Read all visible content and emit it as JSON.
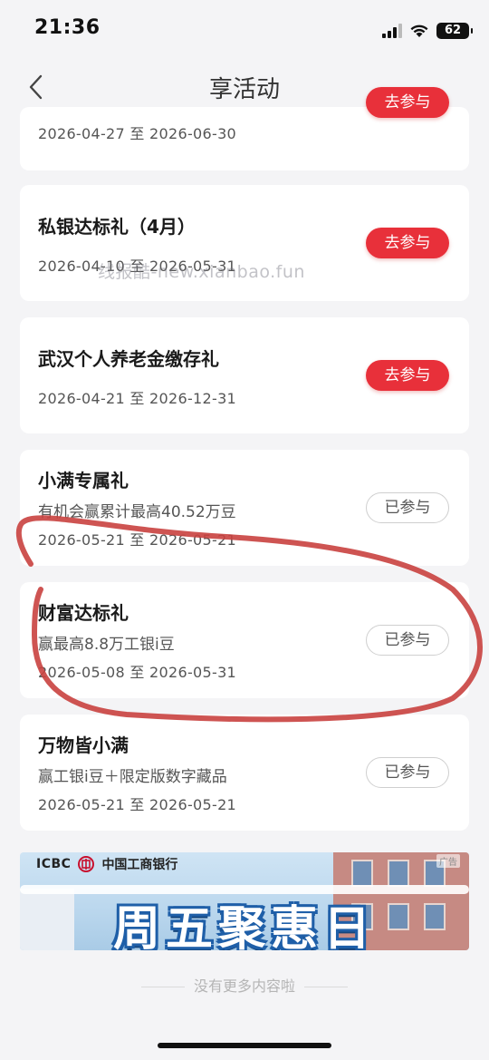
{
  "status_bar": {
    "time": "21:36",
    "battery": "62"
  },
  "nav": {
    "title": "享活动",
    "back_icon": "chevron-left-icon"
  },
  "cards": [
    {
      "title": "",
      "sub": "",
      "date": "2026-04-27 至 2026-06-30",
      "button": "去参与",
      "status": "go"
    },
    {
      "title": "私银达标礼（4月）",
      "sub": "",
      "date": "2026-04-10 至 2026-05-31",
      "button": "去参与",
      "status": "go"
    },
    {
      "title": "武汉个人养老金缴存礼",
      "sub": "",
      "date": "2026-04-21 至 2026-12-31",
      "button": "去参与",
      "status": "go"
    },
    {
      "title": "小满专属礼",
      "sub": "有机会赢累计最高40.52万豆",
      "date": "2026-05-21 至 2026-05-21",
      "button": "已参与",
      "status": "done"
    },
    {
      "title": "财富达标礼",
      "sub": "赢最高8.8万工银i豆",
      "date": "2026-05-08 至 2026-05-31",
      "button": "已参与",
      "status": "done"
    },
    {
      "title": "万物皆小满",
      "sub": "赢工银i豆＋限定版数字藏品",
      "date": "2026-05-21 至 2026-05-21",
      "button": "已参与",
      "status": "done"
    }
  ],
  "watermark": "线报酷-new.xianbao.fun",
  "banner": {
    "brand": "ICBC",
    "bank_name": "中国工商银行",
    "ad_tag": "广告",
    "headline": "周五聚惠日"
  },
  "footer": {
    "no_more": "没有更多内容啦"
  },
  "colors": {
    "accent": "#e8303a",
    "annotation": "#c9413f"
  }
}
